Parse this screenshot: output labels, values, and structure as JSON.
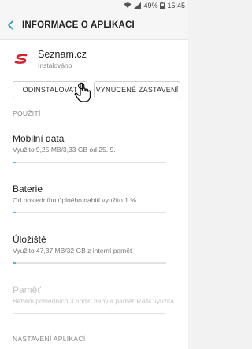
{
  "status_bar": {
    "battery": "49%",
    "time": "15:45"
  },
  "header": {
    "title": "INFORMACE O APLIKACI"
  },
  "app": {
    "name": "Seznam.cz",
    "status": "Instalováno"
  },
  "buttons": {
    "uninstall": "ODINSTALOVAT",
    "force_stop": "VYNUCENÉ ZASTAVENÍ"
  },
  "sections": {
    "usage": "POUŽITÍ",
    "app_settings": "NASTAVENÍ APLIKACÍ"
  },
  "items": [
    {
      "title": "Mobilní data",
      "subtitle": "Využito 9,25 MB/3,33 GB od 25. 9.",
      "progress": 0.003
    },
    {
      "title": "Baterie",
      "subtitle": "Od posledního úplného nabití využito 1 %",
      "progress": 0.01
    },
    {
      "title": "Úložiště",
      "subtitle": "Využito 47,37 MB/32 GB z interní paměť",
      "progress": 0.002
    },
    {
      "title": "Paměť",
      "subtitle": "Během posledních 3 hodin nebyla paměť RAM využita",
      "progress": 0.0,
      "disabled": true
    }
  ],
  "colors": {
    "accent": "#5fb2cf",
    "logo": "#d2232a"
  }
}
